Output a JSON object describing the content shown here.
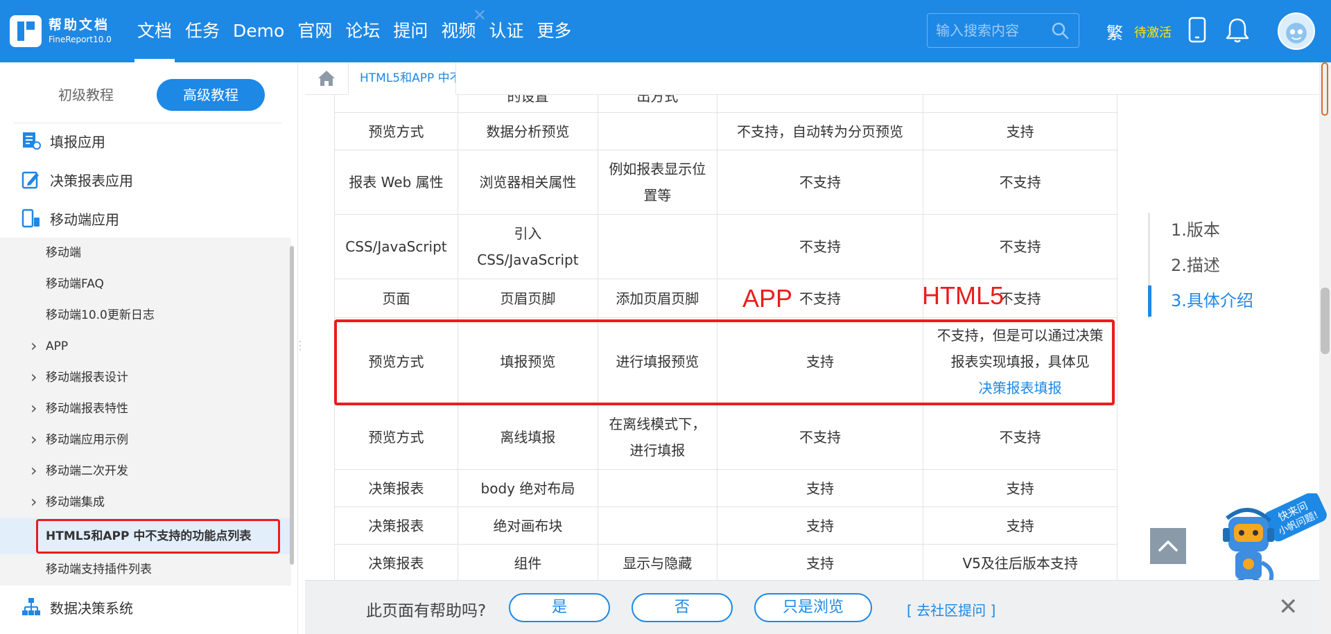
{
  "header": {
    "logo_title": "帮助文档",
    "logo_sub": "FineReport10.0",
    "nav": [
      "文档",
      "任务",
      "Demo",
      "官网",
      "论坛",
      "提问",
      "视频",
      "认证",
      "更多"
    ],
    "search_placeholder": "输入搜索内容",
    "traditional": "繁",
    "activate": "待激活",
    "colors": {
      "brand": "#1e88e5",
      "activate": "#ffe400"
    }
  },
  "sidebar": {
    "tab_basic": "初级教程",
    "tab_advanced": "高级教程",
    "categories": [
      "填报应用",
      "决策报表应用",
      "移动端应用",
      "数据决策系统"
    ],
    "items": [
      "移动端",
      "移动端FAQ",
      "移动端10.0更新日志",
      "APP",
      "移动端报表设计",
      "移动端报表特性",
      "移动端应用示例",
      "移动端二次开发",
      "移动端集成",
      "HTML5和APP 中不支持的功能点列表",
      "移动端支持插件列表"
    ]
  },
  "content_tabs": {
    "doc_tab": "HTML5和APP 中不支持的功能点列表"
  },
  "table": {
    "rows": [
      [
        "",
        "的设置",
        "出方式",
        "",
        ""
      ],
      [
        "预览方式",
        "数据分析预览",
        "",
        "不支持，自动转为分页预览",
        "支持"
      ],
      [
        "报表 Web 属性",
        "浏览器相关属性",
        "例如报表显示位置等",
        "不支持",
        "不支持"
      ],
      [
        "CSS/JavaScript",
        "引入 CSS/JavaScript",
        "",
        "不支持",
        "不支持"
      ],
      [
        "页面",
        "页眉页脚",
        "添加页眉页脚",
        "不支持",
        "不支持"
      ],
      [
        "预览方式",
        "填报预览",
        "进行填报预览",
        "支持",
        "不支持，但是可以通过决策报表实现填报，具体见"
      ],
      [
        "预览方式",
        "离线填报",
        "在离线模式下，进行填报",
        "不支持",
        "不支持"
      ],
      [
        "决策报表",
        "body 绝对布局",
        "",
        "支持",
        "支持"
      ],
      [
        "决策报表",
        "绝对画布块",
        "",
        "支持",
        "支持"
      ],
      [
        "决策报表",
        "组件",
        "显示与隐藏",
        "支持",
        "V5及往后版本支持"
      ]
    ],
    "link_text": "决策报表填报",
    "annotation_app": "APP",
    "annotation_html5": "HTML5"
  },
  "toc": [
    "1.版本",
    "2.描述",
    "3.具体介绍"
  ],
  "feedback": {
    "question": "此页面有帮助吗?",
    "yes": "是",
    "no": "否",
    "browse": "只是浏览",
    "community": "[ 去社区提问 ]",
    "close": "✕"
  },
  "mascot_text": [
    "快来问",
    "小帆问题!"
  ]
}
